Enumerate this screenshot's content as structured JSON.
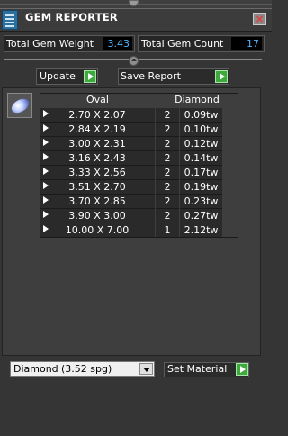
{
  "window": {
    "title": "GEM REPORTER",
    "close_label": "×"
  },
  "icons": {
    "app": "report-icon",
    "close": "close-icon",
    "gem": "oval-gem-icon",
    "arrow": "green-arrow-icon"
  },
  "totals": {
    "weight_label": "Total Gem Weight",
    "weight_value": "3.43",
    "count_label": "Total Gem Count",
    "count_value": "17"
  },
  "toolbar": {
    "update_label": "Update",
    "save_label": "Save Report"
  },
  "table": {
    "shape_header": "Oval",
    "material_header": "Diamond",
    "rows": [
      {
        "size": "2.70 X 2.07",
        "qty": "2",
        "weight": "0.09tw"
      },
      {
        "size": "2.84 X 2.19",
        "qty": "2",
        "weight": "0.10tw"
      },
      {
        "size": "3.00 X 2.31",
        "qty": "2",
        "weight": "0.12tw"
      },
      {
        "size": "3.16 X 2.43",
        "qty": "2",
        "weight": "0.14tw"
      },
      {
        "size": "3.33 X 2.56",
        "qty": "2",
        "weight": "0.17tw"
      },
      {
        "size": "3.51 X 2.70",
        "qty": "2",
        "weight": "0.19tw"
      },
      {
        "size": "3.70 X 2.85",
        "qty": "2",
        "weight": "0.23tw"
      },
      {
        "size": "3.90 X 3.00",
        "qty": "2",
        "weight": "0.27tw"
      },
      {
        "size": "10.00 X 7.00",
        "qty": "1",
        "weight": "2.12tw"
      }
    ]
  },
  "material": {
    "selected": "Diamond",
    "spg": "(3.52 spg)",
    "set_label": "Set Material"
  },
  "colors": {
    "accent_value": "#4fb5ff",
    "button_green": "#3fa93f",
    "close_red": "#e53a3a"
  }
}
